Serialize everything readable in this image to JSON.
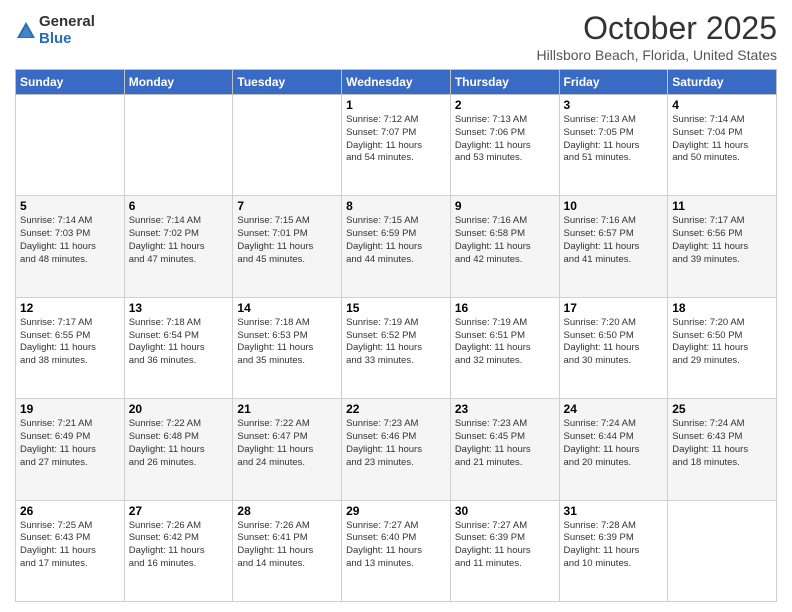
{
  "header": {
    "logo_general": "General",
    "logo_blue": "Blue",
    "title": "October 2025",
    "location": "Hillsboro Beach, Florida, United States"
  },
  "weekdays": [
    "Sunday",
    "Monday",
    "Tuesday",
    "Wednesday",
    "Thursday",
    "Friday",
    "Saturday"
  ],
  "weeks": [
    [
      {
        "day": "",
        "info": ""
      },
      {
        "day": "",
        "info": ""
      },
      {
        "day": "",
        "info": ""
      },
      {
        "day": "1",
        "info": "Sunrise: 7:12 AM\nSunset: 7:07 PM\nDaylight: 11 hours\nand 54 minutes."
      },
      {
        "day": "2",
        "info": "Sunrise: 7:13 AM\nSunset: 7:06 PM\nDaylight: 11 hours\nand 53 minutes."
      },
      {
        "day": "3",
        "info": "Sunrise: 7:13 AM\nSunset: 7:05 PM\nDaylight: 11 hours\nand 51 minutes."
      },
      {
        "day": "4",
        "info": "Sunrise: 7:14 AM\nSunset: 7:04 PM\nDaylight: 11 hours\nand 50 minutes."
      }
    ],
    [
      {
        "day": "5",
        "info": "Sunrise: 7:14 AM\nSunset: 7:03 PM\nDaylight: 11 hours\nand 48 minutes."
      },
      {
        "day": "6",
        "info": "Sunrise: 7:14 AM\nSunset: 7:02 PM\nDaylight: 11 hours\nand 47 minutes."
      },
      {
        "day": "7",
        "info": "Sunrise: 7:15 AM\nSunset: 7:01 PM\nDaylight: 11 hours\nand 45 minutes."
      },
      {
        "day": "8",
        "info": "Sunrise: 7:15 AM\nSunset: 6:59 PM\nDaylight: 11 hours\nand 44 minutes."
      },
      {
        "day": "9",
        "info": "Sunrise: 7:16 AM\nSunset: 6:58 PM\nDaylight: 11 hours\nand 42 minutes."
      },
      {
        "day": "10",
        "info": "Sunrise: 7:16 AM\nSunset: 6:57 PM\nDaylight: 11 hours\nand 41 minutes."
      },
      {
        "day": "11",
        "info": "Sunrise: 7:17 AM\nSunset: 6:56 PM\nDaylight: 11 hours\nand 39 minutes."
      }
    ],
    [
      {
        "day": "12",
        "info": "Sunrise: 7:17 AM\nSunset: 6:55 PM\nDaylight: 11 hours\nand 38 minutes."
      },
      {
        "day": "13",
        "info": "Sunrise: 7:18 AM\nSunset: 6:54 PM\nDaylight: 11 hours\nand 36 minutes."
      },
      {
        "day": "14",
        "info": "Sunrise: 7:18 AM\nSunset: 6:53 PM\nDaylight: 11 hours\nand 35 minutes."
      },
      {
        "day": "15",
        "info": "Sunrise: 7:19 AM\nSunset: 6:52 PM\nDaylight: 11 hours\nand 33 minutes."
      },
      {
        "day": "16",
        "info": "Sunrise: 7:19 AM\nSunset: 6:51 PM\nDaylight: 11 hours\nand 32 minutes."
      },
      {
        "day": "17",
        "info": "Sunrise: 7:20 AM\nSunset: 6:50 PM\nDaylight: 11 hours\nand 30 minutes."
      },
      {
        "day": "18",
        "info": "Sunrise: 7:20 AM\nSunset: 6:50 PM\nDaylight: 11 hours\nand 29 minutes."
      }
    ],
    [
      {
        "day": "19",
        "info": "Sunrise: 7:21 AM\nSunset: 6:49 PM\nDaylight: 11 hours\nand 27 minutes."
      },
      {
        "day": "20",
        "info": "Sunrise: 7:22 AM\nSunset: 6:48 PM\nDaylight: 11 hours\nand 26 minutes."
      },
      {
        "day": "21",
        "info": "Sunrise: 7:22 AM\nSunset: 6:47 PM\nDaylight: 11 hours\nand 24 minutes."
      },
      {
        "day": "22",
        "info": "Sunrise: 7:23 AM\nSunset: 6:46 PM\nDaylight: 11 hours\nand 23 minutes."
      },
      {
        "day": "23",
        "info": "Sunrise: 7:23 AM\nSunset: 6:45 PM\nDaylight: 11 hours\nand 21 minutes."
      },
      {
        "day": "24",
        "info": "Sunrise: 7:24 AM\nSunset: 6:44 PM\nDaylight: 11 hours\nand 20 minutes."
      },
      {
        "day": "25",
        "info": "Sunrise: 7:24 AM\nSunset: 6:43 PM\nDaylight: 11 hours\nand 18 minutes."
      }
    ],
    [
      {
        "day": "26",
        "info": "Sunrise: 7:25 AM\nSunset: 6:43 PM\nDaylight: 11 hours\nand 17 minutes."
      },
      {
        "day": "27",
        "info": "Sunrise: 7:26 AM\nSunset: 6:42 PM\nDaylight: 11 hours\nand 16 minutes."
      },
      {
        "day": "28",
        "info": "Sunrise: 7:26 AM\nSunset: 6:41 PM\nDaylight: 11 hours\nand 14 minutes."
      },
      {
        "day": "29",
        "info": "Sunrise: 7:27 AM\nSunset: 6:40 PM\nDaylight: 11 hours\nand 13 minutes."
      },
      {
        "day": "30",
        "info": "Sunrise: 7:27 AM\nSunset: 6:39 PM\nDaylight: 11 hours\nand 11 minutes."
      },
      {
        "day": "31",
        "info": "Sunrise: 7:28 AM\nSunset: 6:39 PM\nDaylight: 11 hours\nand 10 minutes."
      },
      {
        "day": "",
        "info": ""
      }
    ]
  ]
}
